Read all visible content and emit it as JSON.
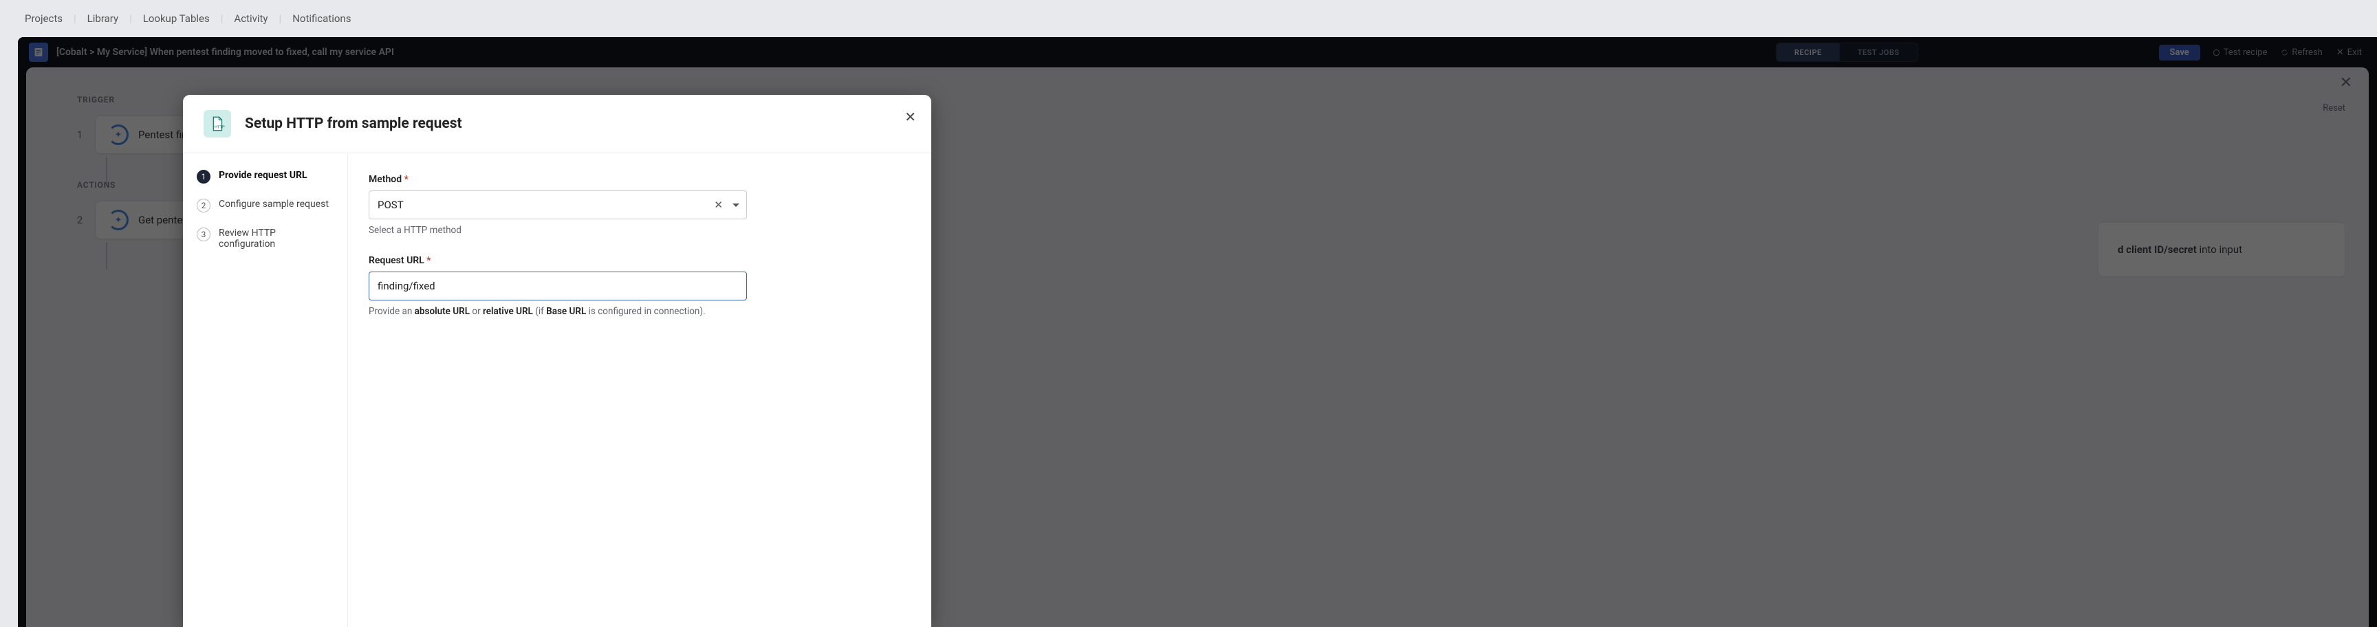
{
  "nav": {
    "items": [
      "Projects",
      "Library",
      "Lookup Tables",
      "Activity",
      "Notifications"
    ]
  },
  "recipe_header": {
    "title": "[Cobalt > My Service] When pentest finding moved to fixed, call my service API",
    "tab_recipe": "RECIPE",
    "tab_test": "TEST JOBS",
    "save": "Save",
    "test": "Test recipe",
    "refresh": "Refresh",
    "exit": "Exit"
  },
  "canvas": {
    "trigger_label": "TRIGGER",
    "actions_label": "ACTIONS",
    "step1_num": "1",
    "step1_text": "Pentest findin",
    "step2_num": "2",
    "step2_text": "Get pentest fin",
    "reset": "Reset",
    "right_peek_suffix": " into input"
  },
  "right_peek_bold": "d client ID/secret",
  "modal": {
    "title": "Setup HTTP from sample request",
    "steps": [
      {
        "num": "1",
        "label": "Provide request URL"
      },
      {
        "num": "2",
        "label": "Configure sample request"
      },
      {
        "num": "3",
        "label": "Review HTTP configuration"
      }
    ],
    "method": {
      "label": "Method",
      "value": "POST",
      "hint": "Select a HTTP method"
    },
    "url": {
      "label": "Request URL",
      "value": "finding/fixed",
      "hint_pre": "Provide an ",
      "hint_abs": "absolute URL",
      "hint_or": " or ",
      "hint_rel": "relative URL",
      "hint_if": " (if ",
      "hint_base": "Base URL",
      "hint_post": " is configured in connection)."
    }
  }
}
